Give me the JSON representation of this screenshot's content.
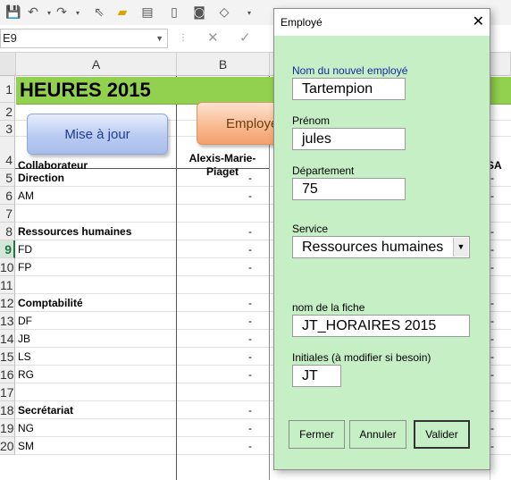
{
  "name_box": {
    "value": "E9"
  },
  "sheet": {
    "columns": [
      "A",
      "B"
    ],
    "rows": [
      "1",
      "2",
      "3",
      "4",
      "5",
      "6",
      "7",
      "8",
      "9",
      "10",
      "11",
      "12",
      "13",
      "14",
      "15",
      "16",
      "17",
      "18",
      "19",
      "20"
    ],
    "title": "HEURES 2015",
    "button_update": "Mise à jour",
    "button_employee": "Employé",
    "header_collab": "Collaborateur",
    "header_b": "Alexis-Marie-Piaget",
    "header_right": "SA",
    "rows_a": [
      {
        "text": "Direction",
        "bold": true
      },
      {
        "text": "AM",
        "bold": false
      },
      {
        "text": "",
        "bold": false
      },
      {
        "text": "Ressources humaines",
        "bold": true
      },
      {
        "text": "FD",
        "bold": false
      },
      {
        "text": "FP",
        "bold": false
      },
      {
        "text": "",
        "bold": false
      },
      {
        "text": "Comptabilité",
        "bold": true
      },
      {
        "text": "DF",
        "bold": false
      },
      {
        "text": "JB",
        "bold": false
      },
      {
        "text": "LS",
        "bold": false
      },
      {
        "text": "RG",
        "bold": false
      },
      {
        "text": "",
        "bold": false
      },
      {
        "text": "Secrétariat",
        "bold": true
      },
      {
        "text": "NG",
        "bold": false
      },
      {
        "text": "SM",
        "bold": false
      }
    ],
    "dash": "-"
  },
  "dialog": {
    "title": "Employé",
    "close": "✕",
    "label_name": "Nom du nouvel employé",
    "value_name": "Tartempion",
    "label_firstname": "Prénom",
    "value_firstname": "jules",
    "label_dept": "Département",
    "value_dept": "75",
    "label_service": "Service",
    "value_service": "Ressources humaines",
    "label_sheet": "nom de la fiche",
    "value_sheet": "JT_HORAIRES 2015",
    "label_initials": "Initiales (à modifier si besoin)",
    "value_initials": "JT",
    "btn_close": "Fermer",
    "btn_cancel": "Annuler",
    "btn_validate": "Valider"
  }
}
